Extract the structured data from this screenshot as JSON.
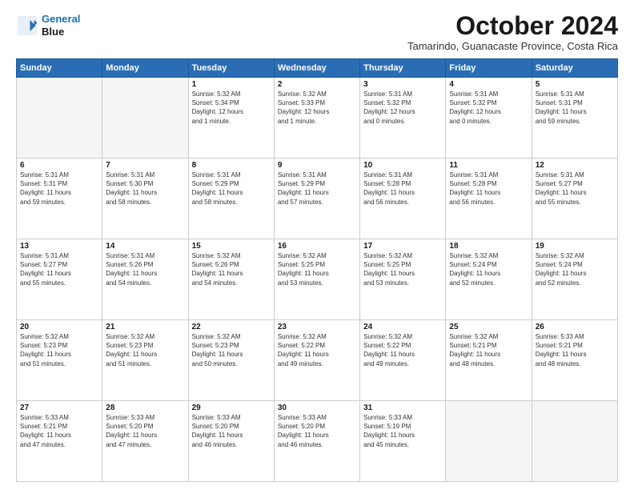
{
  "logo": {
    "line1": "General",
    "line2": "Blue"
  },
  "title": "October 2024",
  "subtitle": "Tamarindo, Guanacaste Province, Costa Rica",
  "days_of_week": [
    "Sunday",
    "Monday",
    "Tuesday",
    "Wednesday",
    "Thursday",
    "Friday",
    "Saturday"
  ],
  "weeks": [
    [
      {
        "day": "",
        "info": ""
      },
      {
        "day": "",
        "info": ""
      },
      {
        "day": "1",
        "info": "Sunrise: 5:32 AM\nSunset: 5:34 PM\nDaylight: 12 hours\nand 1 minute."
      },
      {
        "day": "2",
        "info": "Sunrise: 5:32 AM\nSunset: 5:33 PM\nDaylight: 12 hours\nand 1 minute."
      },
      {
        "day": "3",
        "info": "Sunrise: 5:31 AM\nSunset: 5:32 PM\nDaylight: 12 hours\nand 0 minutes."
      },
      {
        "day": "4",
        "info": "Sunrise: 5:31 AM\nSunset: 5:32 PM\nDaylight: 12 hours\nand 0 minutes."
      },
      {
        "day": "5",
        "info": "Sunrise: 5:31 AM\nSunset: 5:31 PM\nDaylight: 11 hours\nand 59 minutes."
      }
    ],
    [
      {
        "day": "6",
        "info": "Sunrise: 5:31 AM\nSunset: 5:31 PM\nDaylight: 11 hours\nand 59 minutes."
      },
      {
        "day": "7",
        "info": "Sunrise: 5:31 AM\nSunset: 5:30 PM\nDaylight: 11 hours\nand 58 minutes."
      },
      {
        "day": "8",
        "info": "Sunrise: 5:31 AM\nSunset: 5:29 PM\nDaylight: 11 hours\nand 58 minutes."
      },
      {
        "day": "9",
        "info": "Sunrise: 5:31 AM\nSunset: 5:29 PM\nDaylight: 11 hours\nand 57 minutes."
      },
      {
        "day": "10",
        "info": "Sunrise: 5:31 AM\nSunset: 5:28 PM\nDaylight: 11 hours\nand 56 minutes."
      },
      {
        "day": "11",
        "info": "Sunrise: 5:31 AM\nSunset: 5:28 PM\nDaylight: 11 hours\nand 56 minutes."
      },
      {
        "day": "12",
        "info": "Sunrise: 5:31 AM\nSunset: 5:27 PM\nDaylight: 11 hours\nand 55 minutes."
      }
    ],
    [
      {
        "day": "13",
        "info": "Sunrise: 5:31 AM\nSunset: 5:27 PM\nDaylight: 11 hours\nand 55 minutes."
      },
      {
        "day": "14",
        "info": "Sunrise: 5:31 AM\nSunset: 5:26 PM\nDaylight: 11 hours\nand 54 minutes."
      },
      {
        "day": "15",
        "info": "Sunrise: 5:32 AM\nSunset: 5:26 PM\nDaylight: 11 hours\nand 54 minutes."
      },
      {
        "day": "16",
        "info": "Sunrise: 5:32 AM\nSunset: 5:25 PM\nDaylight: 11 hours\nand 53 minutes."
      },
      {
        "day": "17",
        "info": "Sunrise: 5:32 AM\nSunset: 5:25 PM\nDaylight: 11 hours\nand 53 minutes."
      },
      {
        "day": "18",
        "info": "Sunrise: 5:32 AM\nSunset: 5:24 PM\nDaylight: 11 hours\nand 52 minutes."
      },
      {
        "day": "19",
        "info": "Sunrise: 5:32 AM\nSunset: 5:24 PM\nDaylight: 11 hours\nand 52 minutes."
      }
    ],
    [
      {
        "day": "20",
        "info": "Sunrise: 5:32 AM\nSunset: 5:23 PM\nDaylight: 11 hours\nand 51 minutes."
      },
      {
        "day": "21",
        "info": "Sunrise: 5:32 AM\nSunset: 5:23 PM\nDaylight: 11 hours\nand 51 minutes."
      },
      {
        "day": "22",
        "info": "Sunrise: 5:32 AM\nSunset: 5:23 PM\nDaylight: 11 hours\nand 50 minutes."
      },
      {
        "day": "23",
        "info": "Sunrise: 5:32 AM\nSunset: 5:22 PM\nDaylight: 11 hours\nand 49 minutes."
      },
      {
        "day": "24",
        "info": "Sunrise: 5:32 AM\nSunset: 5:22 PM\nDaylight: 11 hours\nand 49 minutes."
      },
      {
        "day": "25",
        "info": "Sunrise: 5:32 AM\nSunset: 5:21 PM\nDaylight: 11 hours\nand 48 minutes."
      },
      {
        "day": "26",
        "info": "Sunrise: 5:33 AM\nSunset: 5:21 PM\nDaylight: 11 hours\nand 48 minutes."
      }
    ],
    [
      {
        "day": "27",
        "info": "Sunrise: 5:33 AM\nSunset: 5:21 PM\nDaylight: 11 hours\nand 47 minutes."
      },
      {
        "day": "28",
        "info": "Sunrise: 5:33 AM\nSunset: 5:20 PM\nDaylight: 11 hours\nand 47 minutes."
      },
      {
        "day": "29",
        "info": "Sunrise: 5:33 AM\nSunset: 5:20 PM\nDaylight: 11 hours\nand 46 minutes."
      },
      {
        "day": "30",
        "info": "Sunrise: 5:33 AM\nSunset: 5:20 PM\nDaylight: 11 hours\nand 46 minutes."
      },
      {
        "day": "31",
        "info": "Sunrise: 5:33 AM\nSunset: 5:19 PM\nDaylight: 11 hours\nand 45 minutes."
      },
      {
        "day": "",
        "info": ""
      },
      {
        "day": "",
        "info": ""
      }
    ]
  ]
}
